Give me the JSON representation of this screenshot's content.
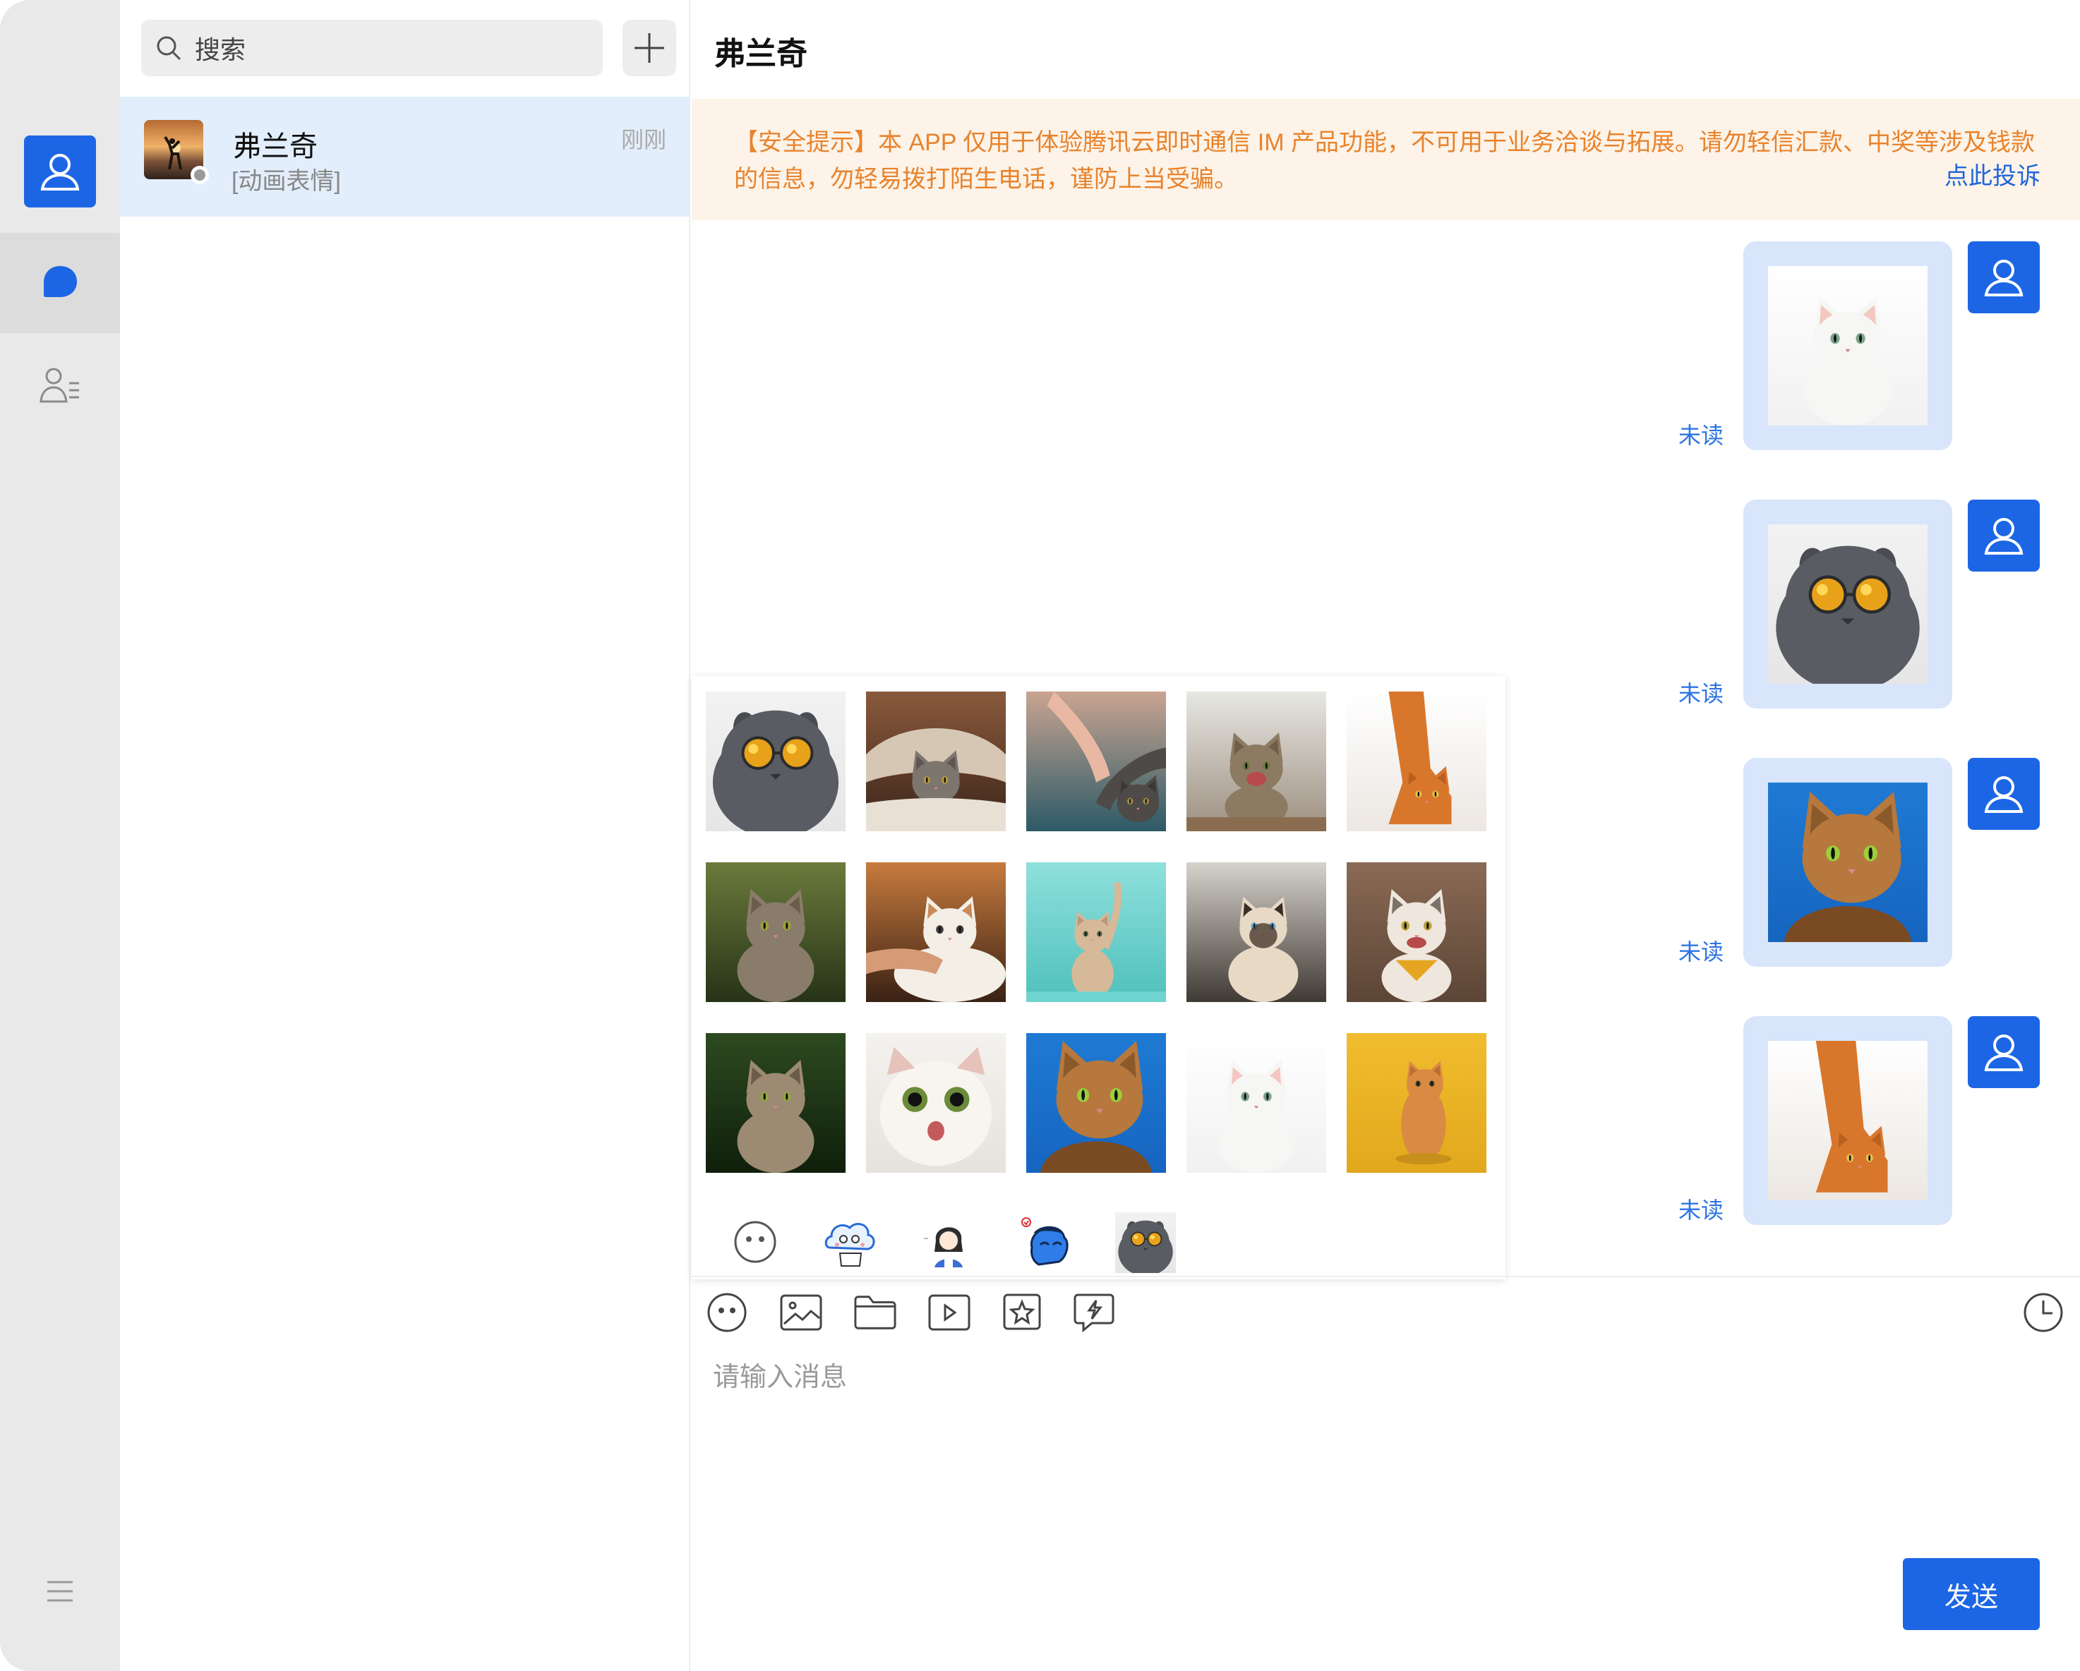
{
  "search": {
    "placeholder": "搜索"
  },
  "conversations": [
    {
      "name": "弗兰奇",
      "last_message": "[动画表情]",
      "time": "刚刚"
    }
  ],
  "chat": {
    "title": "弗兰奇",
    "notice": "【安全提示】本 APP 仅用于体验腾讯云即时通信 IM 产品功能，不可用于业务洽谈与拓展。请勿轻信汇款、中奖等涉及钱款的信息，勿轻易拨打陌生电话，谨防上当受骗。",
    "report_link": "点此投诉",
    "messages": [
      {
        "status": "未读",
        "image": "white-cat"
      },
      {
        "status": "未读",
        "image": "cat-sunglasses"
      },
      {
        "status": "未读",
        "image": "cat-blue-bg"
      },
      {
        "status": "未读",
        "image": "orange-cat-stretch"
      }
    ],
    "input_placeholder": "请输入消息",
    "send_label": "发送"
  },
  "sticker_panel": {
    "stickers": [
      "cat-sunglasses",
      "cat-under-blanket",
      "cat-paw-high-five",
      "kitten-meowing",
      "orange-cat-stretch",
      "tabby-sitting",
      "cat-being-petted",
      "kitten-reaching",
      "siamese-cat",
      "cat-yellow-bandana",
      "tabby-kitten",
      "surprised-white-cat",
      "cat-blue-bg",
      "white-cat",
      "cat-yellow-bg"
    ],
    "tabs": [
      "emoji-tab",
      "cloud-character-tab",
      "girl-character-tab",
      "blue-character-tab",
      "cat-sunglasses-tab"
    ]
  },
  "colors": {
    "accent": "#1c66e5",
    "notice_text": "#e8832c",
    "notice_bg": "#fdf3e8",
    "unread": "#2d74e3",
    "selected_conv": "#e3eefc"
  }
}
